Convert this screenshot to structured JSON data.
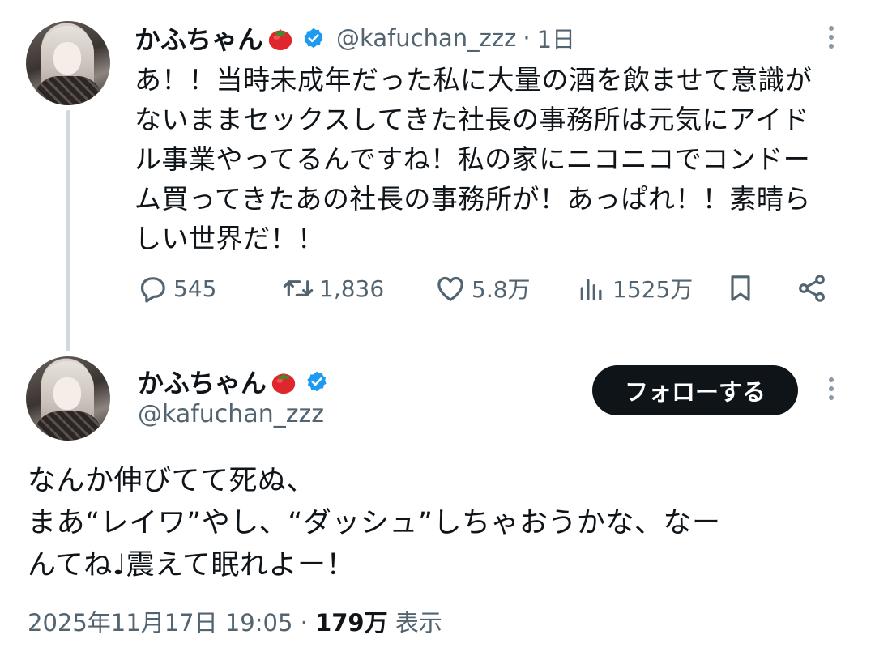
{
  "parent_tweet": {
    "author_name": "かふちゃん",
    "handle": "@kafuchan_zzz",
    "separator": "·",
    "time": "1日",
    "text": "あ！！当時未成年だった私に大量の酒を飲ませて意識が\nないままセックスしてきた社長の事務所は元気にアイド\nル事業やってるんですね！私の家にニコニコでコンドー\nム買ってきたあの社長の事務所が！あっぱれ！！素晴ら\nしい世界だ！！",
    "stats": {
      "replies": "545",
      "retweets": "1,836",
      "likes": "5.8万",
      "views": "1525万"
    },
    "icons": [
      "reply-icon",
      "retweet-icon",
      "like-icon",
      "views-icon",
      "bookmark-icon",
      "share-icon",
      "more-icon",
      "verified-badge-icon",
      "tomato-emoji-icon"
    ]
  },
  "main_tweet": {
    "author_name": "かふちゃん",
    "handle": "@kafuchan_zzz",
    "follow_label": "フォローする",
    "text": "なんか伸びてて死ぬ、\nまあ“レイワ”やし、“ダッシュ”しちゃおうかな、なー\nんてね♩震えて眠れよー！",
    "timestamp": "2025年11月17日 19:05",
    "meta_separator": "·",
    "views_count": "179万",
    "views_label": "表示"
  },
  "colors": {
    "text": "#0f1419",
    "secondary": "#536471",
    "verified": "#1d9bf0",
    "thread_line": "#cfd9de",
    "follow_button": "#0f1419"
  }
}
